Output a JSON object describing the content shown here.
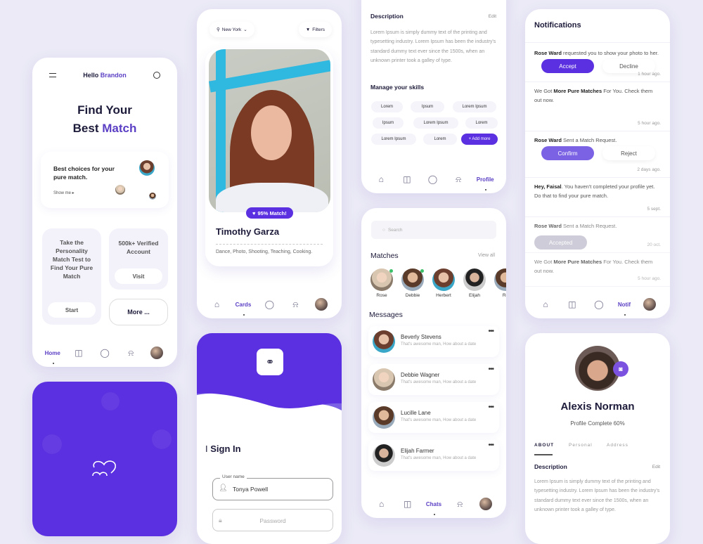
{
  "colors": {
    "accent": "#5b30e0",
    "accent_light": "#7b62e4",
    "background": "#ebeaf6",
    "muted_button": "#b8b7c8"
  },
  "home": {
    "greeting": "Hello",
    "user": "Brandon",
    "title_line1": "Find Your",
    "title_line2_a": "Best",
    "title_line2_b": "Match",
    "card_text": "Best choices for your pure match.",
    "show_me": "Show me ▸",
    "test_card": "Take the Personality Match Test to Find Your Pure Match",
    "start": "Start",
    "verified": "500k+ Verified Account",
    "visit": "Visit",
    "more": "More ...",
    "nav_active": "Home"
  },
  "cards": {
    "location": "New York",
    "filters": "Filters",
    "match_badge": "95% Match!",
    "name": "Timothy Garza",
    "interests": "Dance, Photo, Shooting, Teaching, Cooking.",
    "nav_active": "Cards"
  },
  "signin": {
    "title": "Sign In",
    "username_label": "User name",
    "username_value": "Tonya Powell",
    "password_placeholder": "Password"
  },
  "skills": {
    "description_title": "Description",
    "edit": "Edit",
    "description": "Lorem Ipsum is simply dummy text of the printing and typesetting industry. Lorem Ipsum has been the industry's standard dummy text ever since the 1500s, when an unknown printer took a galley of type.",
    "skills_title": "Manage your skills",
    "chips": [
      "Lorem",
      "Ipsum",
      "Lorem Ipsum",
      "Ipsum",
      "Lorem Ipsum",
      "Lorem",
      "Lorem Ipsum",
      "Lorem"
    ],
    "add_more": "+ Add more",
    "nav_active": "Profile"
  },
  "chats": {
    "search_placeholder": "Search",
    "matches_title": "Matches",
    "view_all": "View all",
    "matches": [
      "Rose",
      "Debbie",
      "Herbert",
      "Elijah",
      "Ro"
    ],
    "messages_title": "Messages",
    "messages": [
      {
        "name": "Beverly Stevens",
        "text": "That's awesome man, How about a date"
      },
      {
        "name": "Debbie Wagner",
        "text": "That's awesome man, How about a date"
      },
      {
        "name": "Lucille Lane",
        "text": "That's awesome man, How about a date"
      },
      {
        "name": "Elijah Farmer",
        "text": "That's awesome man, How about a date"
      }
    ],
    "nav_active": "Chats"
  },
  "notifications": {
    "title": "Notifications",
    "items": [
      {
        "bold": "Rose Ward",
        "text": " requested you to show your photo to her.",
        "time": "1 hour ago.",
        "primary": "Accept",
        "secondary": "Decline"
      },
      {
        "pre": "We Got ",
        "bold": "More Pure Matches",
        "text": " For You. Check them out now.",
        "time": "5 hour ago."
      },
      {
        "bold": "Rose Ward",
        "text": " Sent a Match Request.",
        "time": "2 days ago.",
        "primary": "Confirm",
        "secondary": "Reject"
      },
      {
        "bold": "Hey, Faisal",
        "text": ". You haven't completed your profile yet. Do that to find your pure match.",
        "time": "5 sept."
      },
      {
        "bold": "Rose Ward",
        "text": " Sent a Match Request.",
        "time": "20 oct.",
        "primary": "Accepted"
      },
      {
        "pre": "We Got ",
        "bold": "More Pure Matches",
        "text": " For You. Check them out now.",
        "time": "5 hour ago."
      }
    ],
    "nav_active": "Notif"
  },
  "profile": {
    "name": "Alexis Norman",
    "complete": "Profile Complete 60%",
    "complete_percent": 60,
    "tabs": [
      "ABOUT",
      "Personal",
      "Address"
    ],
    "description_title": "Description",
    "edit": "Edit",
    "description": "Lorem Ipsum is simply dummy text of the printing and typesetting industry. Lorem Ipsum has been the industry's standard dummy text ever since the 1500s, when an unknown printer took a galley of type."
  }
}
